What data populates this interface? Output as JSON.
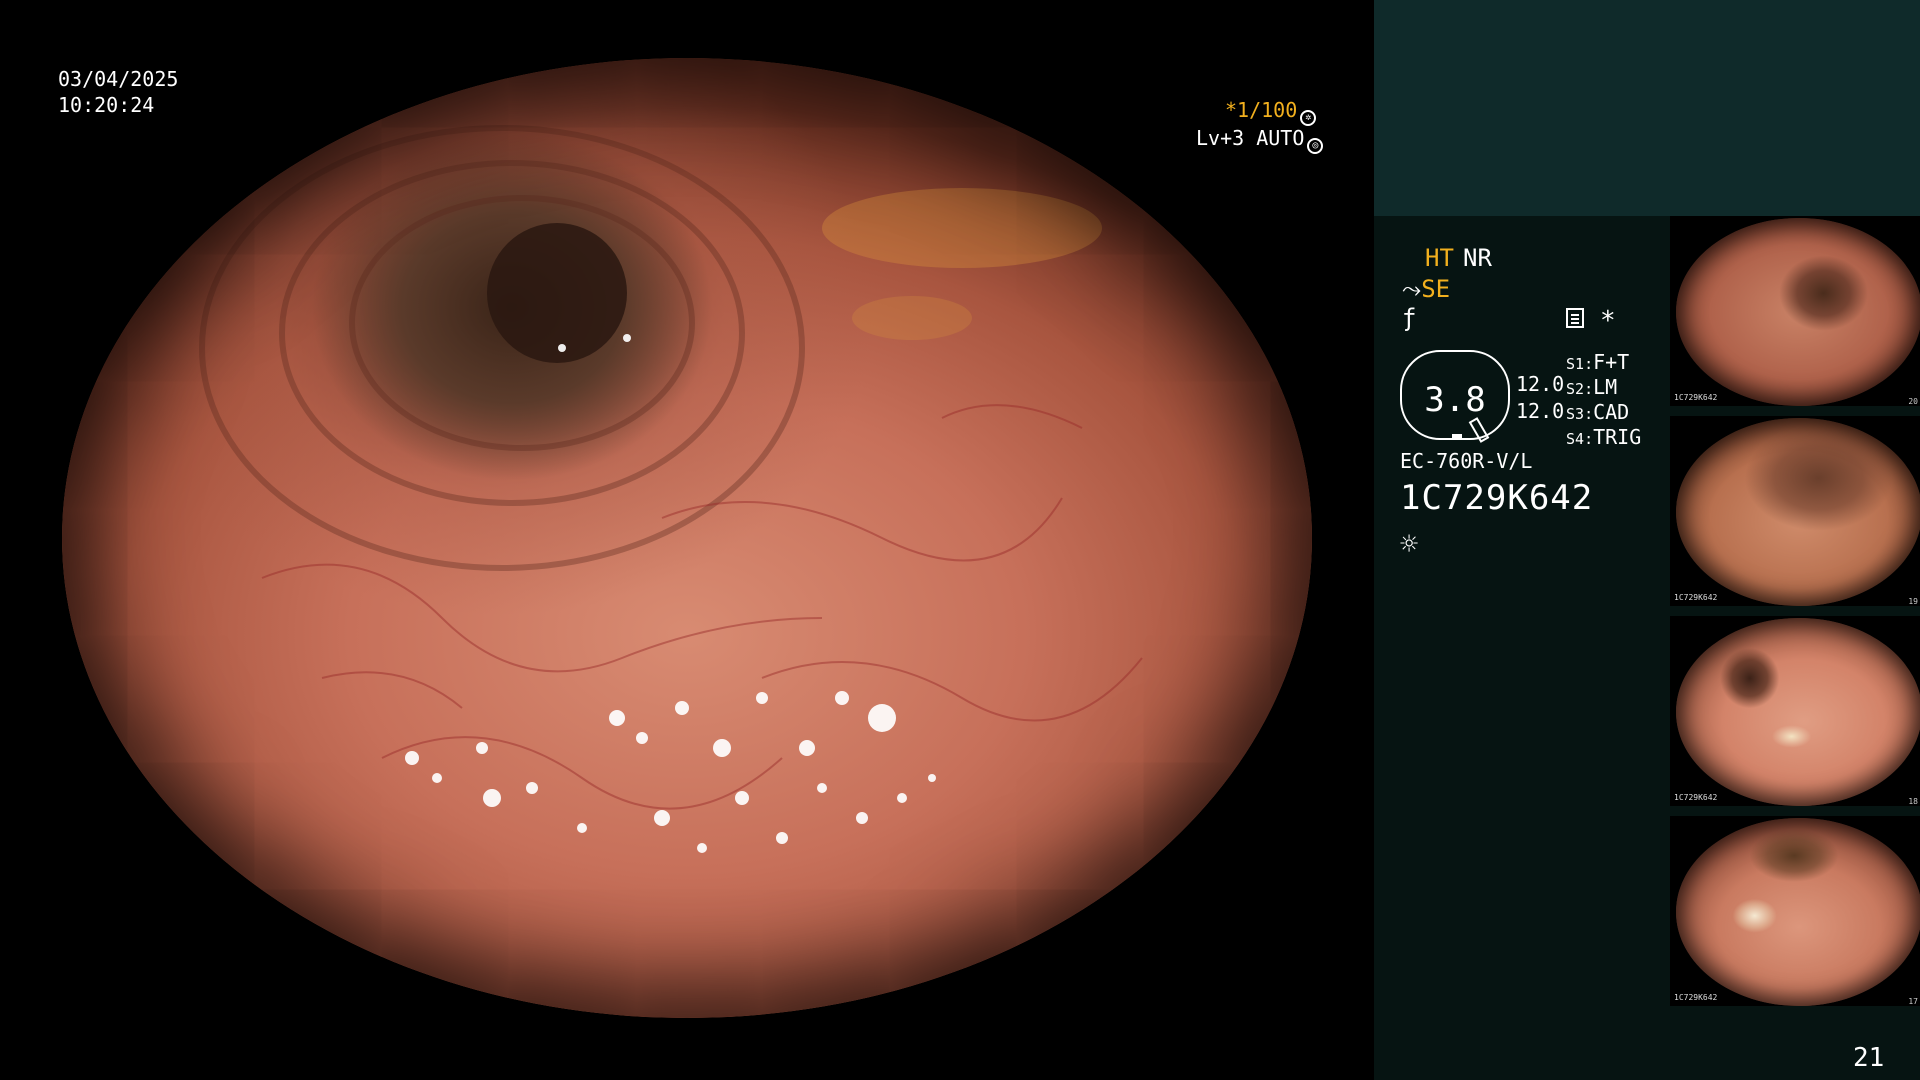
{
  "overlay": {
    "date": "03/04/2025",
    "time": "10:20:24",
    "shutter": "1/100",
    "shutter_prefix": "*",
    "enhance_level": "Lv+3 AUTO"
  },
  "panel": {
    "ht": "HT",
    "nr": "NR",
    "se": "SE",
    "se_icon": "scope-icon",
    "wave": "ƒ",
    "star": "*",
    "zoom": "3.8",
    "value_a": "12.0",
    "value_b": "12.0",
    "switches": [
      {
        "key": "S1",
        "value": "F+T"
      },
      {
        "key": "S2",
        "value": "LM"
      },
      {
        "key": "S3",
        "value": "CAD"
      },
      {
        "key": "S4",
        "value": "TRIG"
      }
    ],
    "scope_model": "EC-760R-V/L",
    "scope_serial": "1C729K642",
    "light_icon": "☼"
  },
  "thumbnails": [
    {
      "id": "1C729K642",
      "num": "20"
    },
    {
      "id": "1C729K642",
      "num": "19"
    },
    {
      "id": "1C729K642",
      "num": "18"
    },
    {
      "id": "1C729K642",
      "num": "17"
    }
  ],
  "page_number": "21",
  "colors": {
    "accent": "#f2b01e",
    "panel_top": "#0f2a2a",
    "panel_bottom": "#061412"
  }
}
